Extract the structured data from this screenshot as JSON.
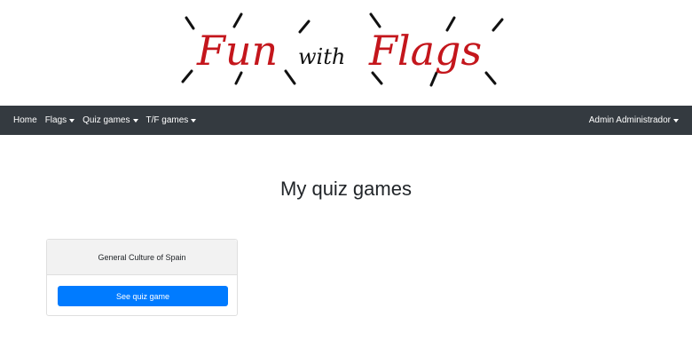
{
  "logo": {
    "word1": "Fun",
    "word2": "with",
    "word3": "Flags"
  },
  "nav": {
    "home": "Home",
    "flags": "Flags",
    "quiz_games": "Quiz games",
    "tf_games": "T/F games",
    "user": "Admin Administrador"
  },
  "page": {
    "title": "My quiz games"
  },
  "cards": [
    {
      "title": "General Culture of Spain",
      "button": "See quiz game"
    }
  ],
  "colors": {
    "navbar_bg": "#343a40",
    "logo_red": "#c4161c",
    "primary": "#007bff",
    "card_header_bg": "#f2f2f2"
  }
}
